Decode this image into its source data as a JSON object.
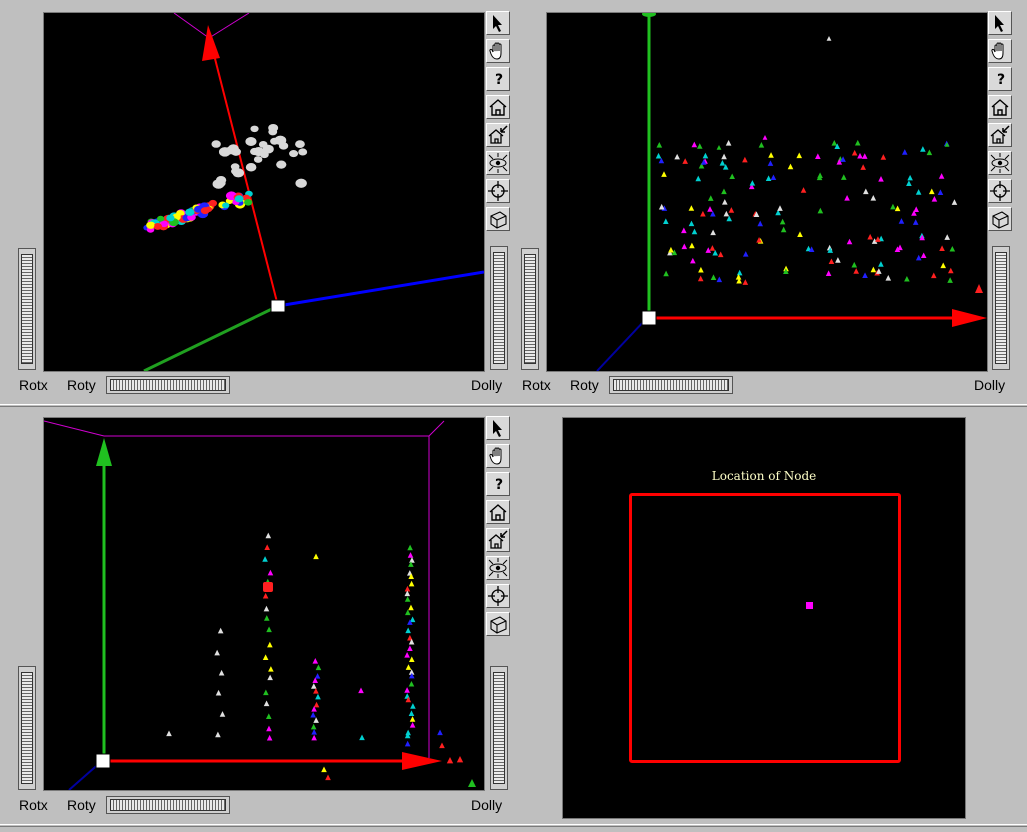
{
  "labels": {
    "rotx": "Rotx",
    "roty": "Roty",
    "dolly": "Dolly"
  },
  "tools": [
    "pick-arrow-icon",
    "hand-icon",
    "question-icon",
    "home-icon",
    "set-home-icon",
    "eye-view-all-icon",
    "seek-target-icon",
    "perspective-toggle-icon"
  ],
  "map": {
    "title": "Location of Node",
    "node_color": "#ff00ff",
    "boundary_color": "#ff0000"
  },
  "colors": {
    "x_axis": "#ff0000",
    "y_axis": "#00c000",
    "z_axis": "#0000ff",
    "bounding_box": "#d000d0",
    "marker_palette": [
      "#ff2020",
      "#20c020",
      "#2020ff",
      "#ffff00",
      "#00d0d0",
      "#ff00ff",
      "#e0e0e0"
    ]
  }
}
